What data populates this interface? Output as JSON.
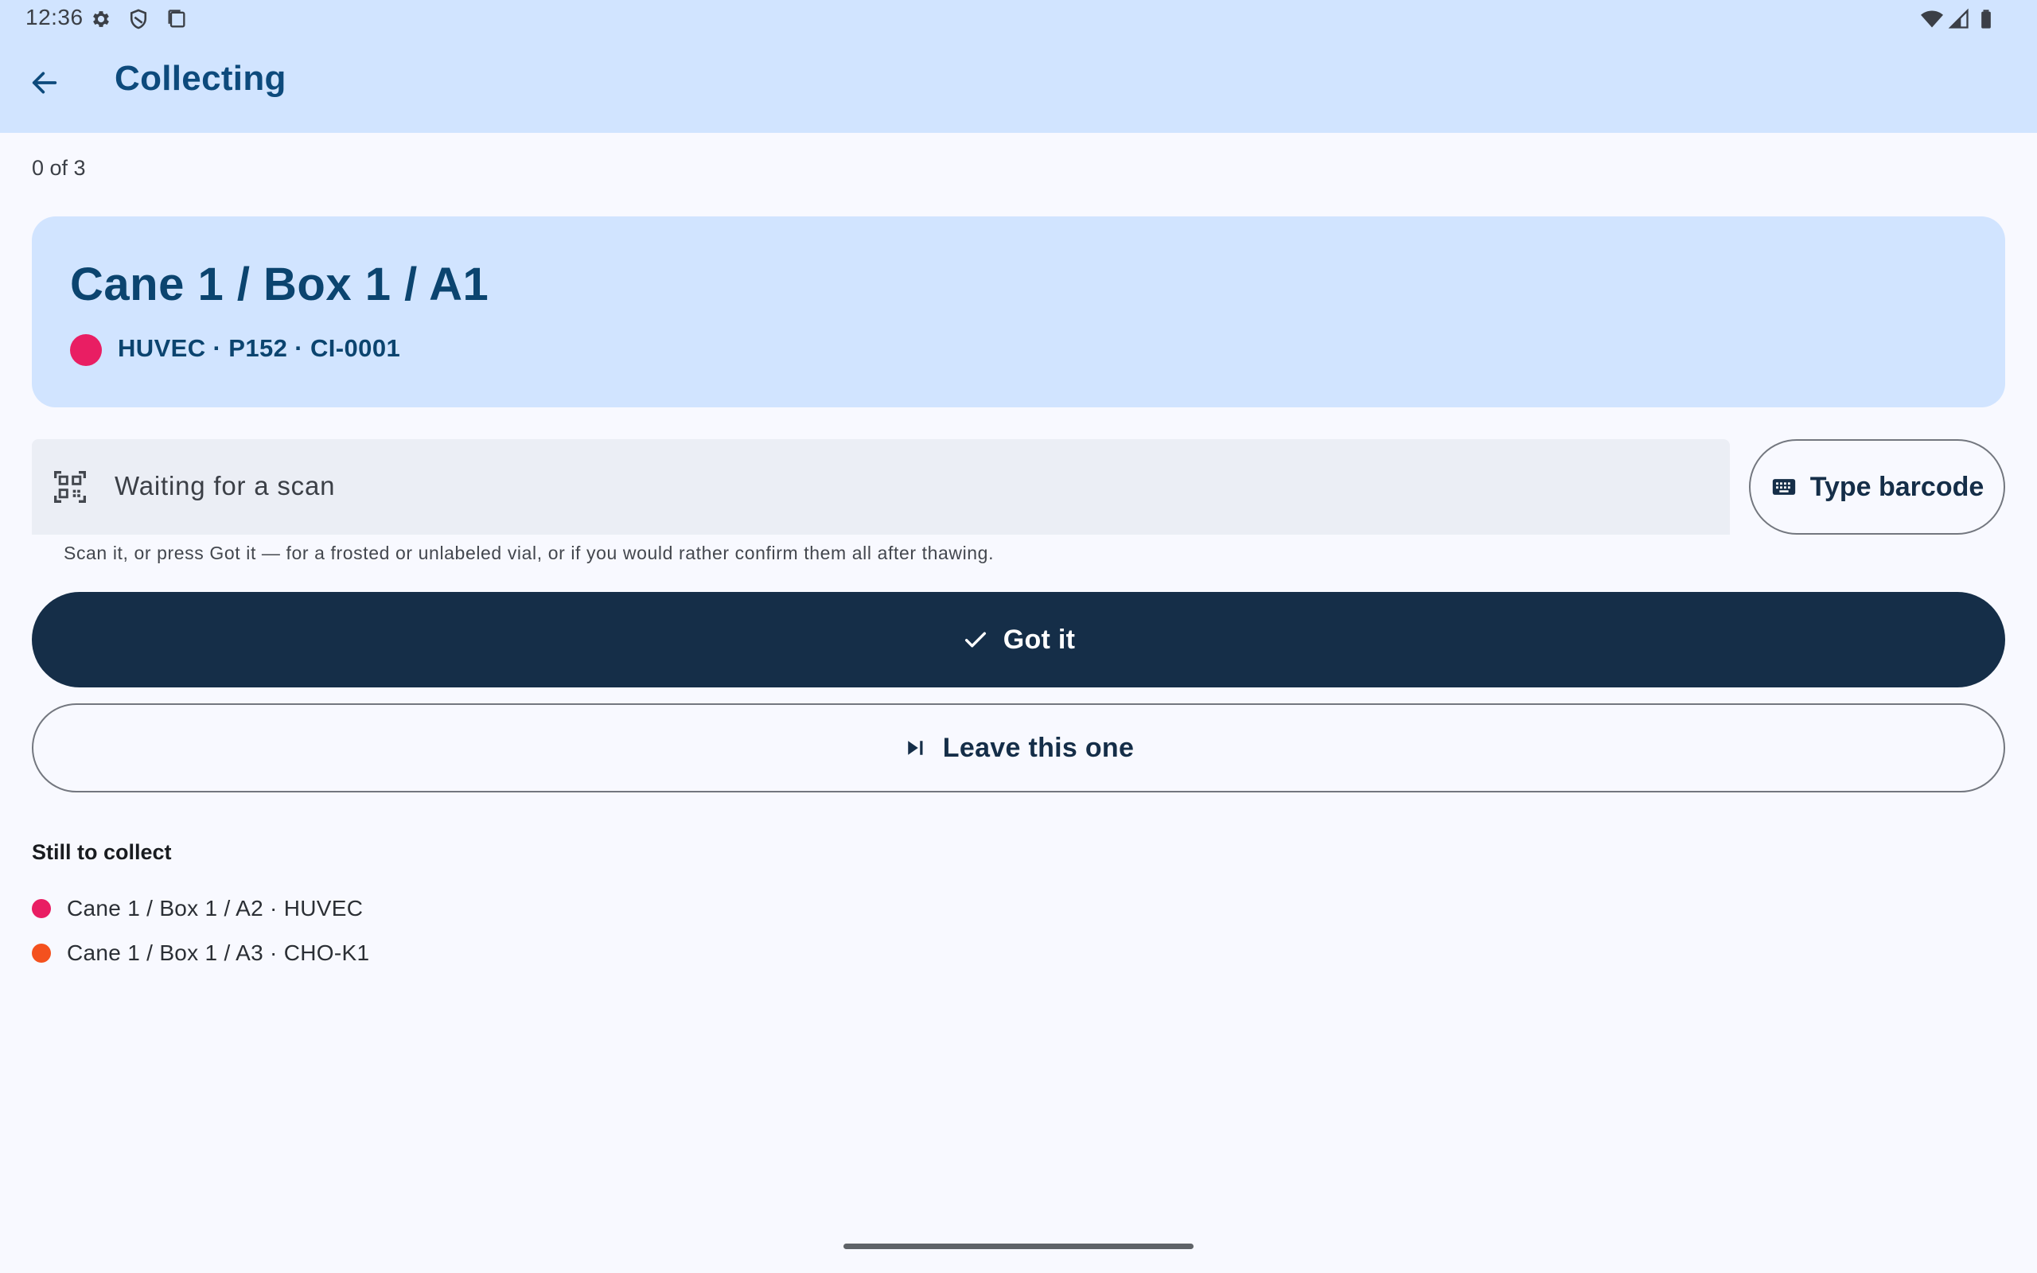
{
  "status_bar": {
    "time": "12:36",
    "icons": [
      "settings-gear-icon",
      "shield-icon",
      "clipboard-icon",
      "wifi-icon",
      "signal-icon",
      "battery-icon"
    ]
  },
  "app_bar": {
    "title": "Collecting",
    "back_icon": "arrow-back-icon"
  },
  "progress": {
    "text": "0 of 3"
  },
  "current_item": {
    "location": "Cane 1 / Box 1 / A1",
    "details": "HUVEC · P152 · CI-0001",
    "dot_color": "#e91e63"
  },
  "scan": {
    "status_text": "Waiting for a scan",
    "icon": "qr-code-scanner-icon",
    "type_barcode_label": "Type barcode",
    "type_barcode_icon": "keyboard-icon",
    "helper_text": "Scan it, or press Got it — for a frosted or unlabeled vial, or if you would rather confirm them all after thawing."
  },
  "actions": {
    "got_it_label": "Got it",
    "got_it_icon": "check-icon",
    "leave_label": "Leave this one",
    "leave_icon": "skip-next-icon"
  },
  "remaining": {
    "header": "Still to collect",
    "items": [
      {
        "label": "Cane 1 / Box 1 / A2 · HUVEC",
        "dot_color": "#e91e63"
      },
      {
        "label": "Cane 1 / Box 1 / A3 · CHO-K1",
        "dot_color": "#f4511e"
      }
    ]
  },
  "colors": {
    "app_bar_bg": "#d1e4ff",
    "primary_dark": "#152e48",
    "title_blue": "#0d4a7c",
    "background": "#f8f9ff"
  }
}
